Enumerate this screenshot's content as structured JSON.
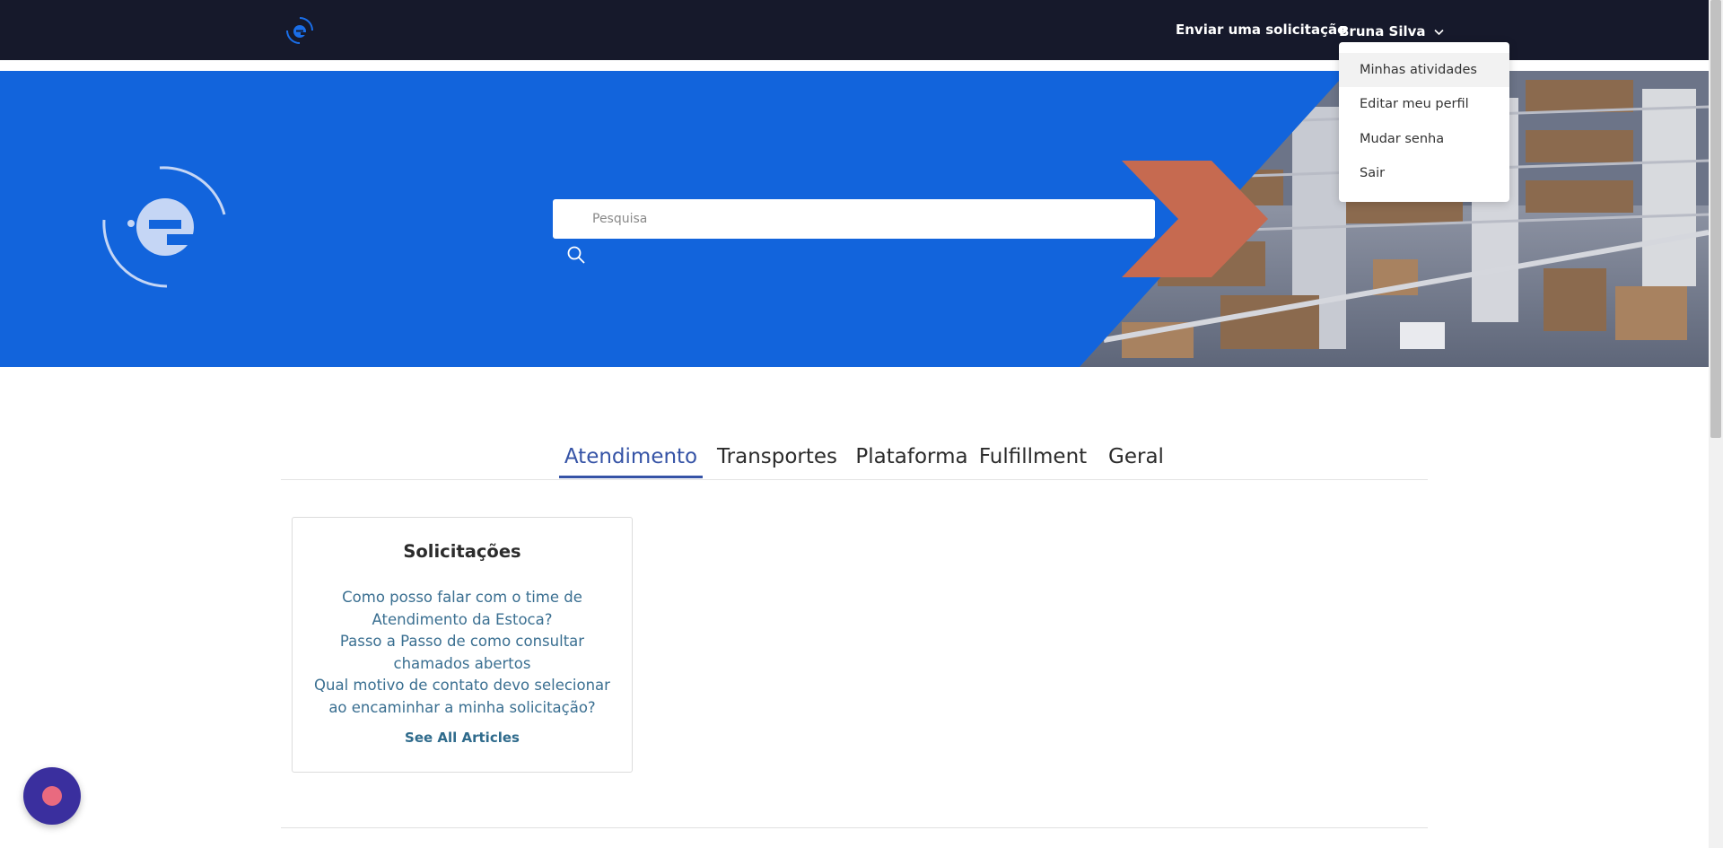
{
  "nav": {
    "submit_request": "Enviar uma solicitação",
    "user_name": "Bruna Silva",
    "user_menu_items": [
      "Minhas atividades",
      "Editar meu perfil",
      "Mudar senha",
      "Sair"
    ]
  },
  "hero": {
    "search_placeholder": "Pesquisa",
    "logo_icon": "estoca-logo-icon",
    "search_icon": "search-icon"
  },
  "tabs": [
    "Atendimento",
    "Transportes",
    "Plataforma",
    "Fulfillment",
    "Geral"
  ],
  "active_tab": "Atendimento",
  "card": {
    "title": "Solicitações",
    "articles": [
      "Como posso falar com o time de Atendimento da Estoca?",
      "Passo a Passo de como consultar chamados abertos",
      "Qual motivo de contato devo selecionar ao encaminhar a minha solicitação?"
    ],
    "see_all": "See All Articles"
  },
  "colors": {
    "topbar": "#16192b",
    "hero_blue": "#1264dc",
    "accent_orange": "#c66a50",
    "tab_active": "#3553a6",
    "link": "#3a6f91",
    "chat_bubble": "#3a2f9e",
    "chat_dot": "#e96a7f"
  }
}
